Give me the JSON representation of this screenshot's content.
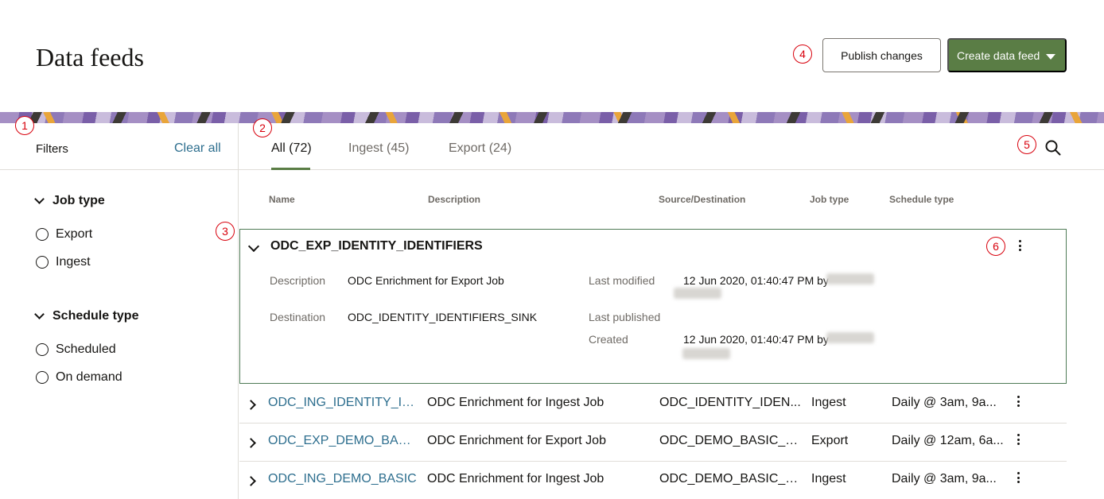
{
  "header": {
    "title": "Data feeds",
    "publish_label": "Publish changes",
    "create_label": "Create data feed"
  },
  "callouts": [
    "1",
    "2",
    "3",
    "4",
    "5",
    "6"
  ],
  "filters": {
    "label": "Filters",
    "clear_all": "Clear all",
    "groups": [
      {
        "title": "Job type",
        "options": [
          "Export",
          "Ingest"
        ]
      },
      {
        "title": "Schedule type",
        "options": [
          "Scheduled",
          "On demand"
        ]
      }
    ]
  },
  "tabs": [
    {
      "label": "All (72)",
      "active": true
    },
    {
      "label": "Ingest (45)",
      "active": false
    },
    {
      "label": "Export (24)",
      "active": false
    }
  ],
  "columns": [
    "Name",
    "Description",
    "Source/Destination",
    "Job type",
    "Schedule type"
  ],
  "expanded_row": {
    "name": "ODC_EXP_IDENTITY_IDENTIFIERS",
    "description_label": "Description",
    "description_value": "ODC Enrichment for Export Job",
    "destination_label": "Destination",
    "destination_value": "ODC_IDENTITY_IDENTIFIERS_SINK",
    "last_modified_label": "Last modified",
    "last_modified_value": "12 Jun 2020, 01:40:47 PM by",
    "last_published_label": "Last published",
    "created_label": "Created",
    "created_value": "12 Jun 2020, 01:40:47 PM by"
  },
  "rows": [
    {
      "name": "ODC_ING_IDENTITY_ID...",
      "description": "ODC Enrichment for Ingest Job",
      "source": "ODC_IDENTITY_IDEN...",
      "job_type": "Ingest",
      "schedule": "Daily @ 3am, 9a..."
    },
    {
      "name": "ODC_EXP_DEMO_BASIC",
      "description": "ODC Enrichment for Export Job",
      "source": "ODC_DEMO_BASIC_SI...",
      "job_type": "Export",
      "schedule": "Daily @ 12am, 6a..."
    },
    {
      "name": "ODC_ING_DEMO_BASIC",
      "description": "ODC Enrichment for Ingest Job",
      "source": "ODC_DEMO_BASIC_S...",
      "job_type": "Ingest",
      "schedule": "Daily @ 3am, 9a..."
    }
  ],
  "colors": {
    "accent": "#5a7d45",
    "link": "#2d6e8e",
    "callout": "#d8000c",
    "expanded_border": "#4e7a55"
  }
}
